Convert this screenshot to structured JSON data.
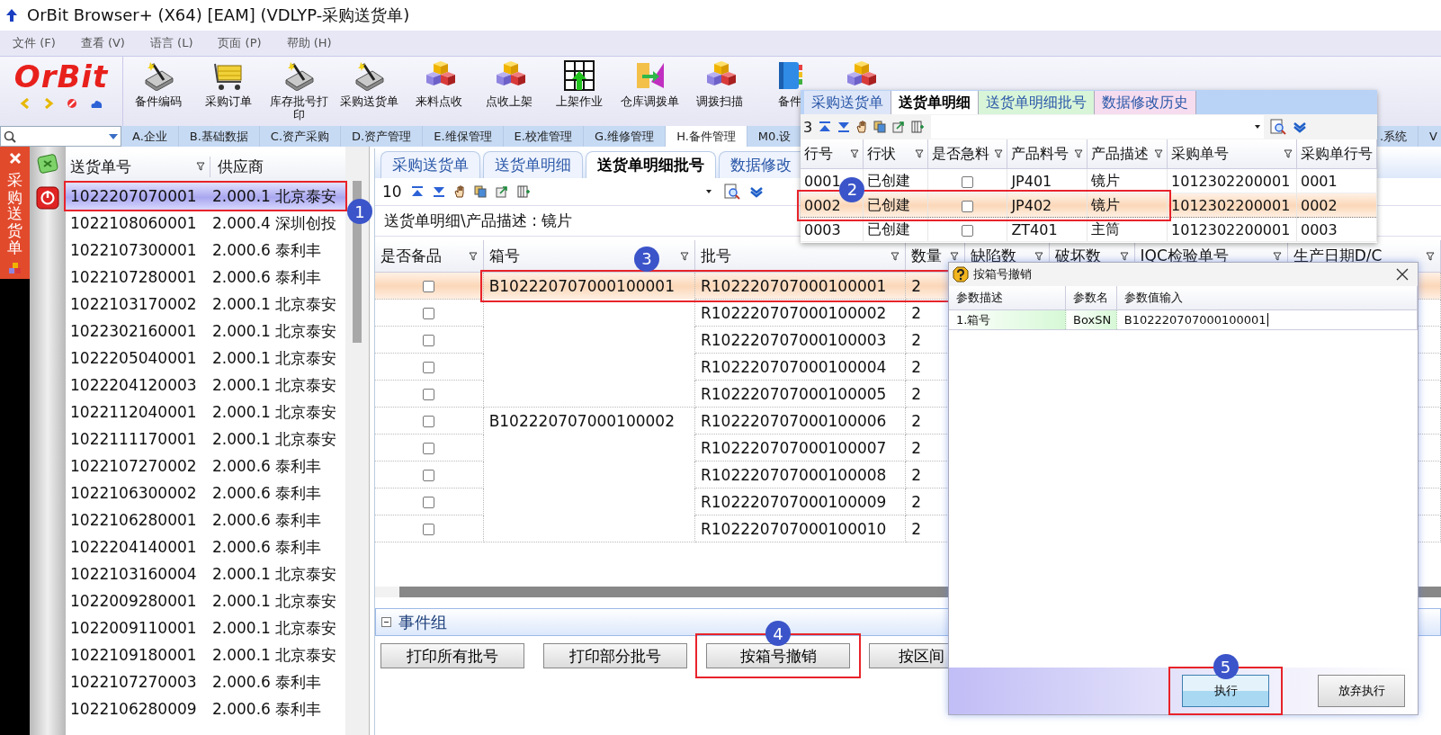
{
  "window": {
    "title": "OrBit Browser+ (X64) [EAM] (VDLYP-采购送货单)"
  },
  "menu": [
    "文件 (F)",
    "查看 (V)",
    "语言 (L)",
    "页面 (P)",
    "帮助 (H)"
  ],
  "logo": "OrBit",
  "toolbar": [
    {
      "label": "备件编码",
      "kind": "tray"
    },
    {
      "label": "采购订单",
      "kind": "cart"
    },
    {
      "label": "库存批号打印",
      "kind": "tray"
    },
    {
      "label": "采购送货单",
      "kind": "tray"
    },
    {
      "label": "来料点收",
      "kind": "cubes"
    },
    {
      "label": "点收上架",
      "kind": "cubes"
    },
    {
      "label": "上架作业",
      "kind": "grid"
    },
    {
      "label": "仓库调拨单",
      "kind": "transfer"
    },
    {
      "label": "调拨扫描",
      "kind": "cubes"
    },
    {
      "label": "备件",
      "kind": "binder"
    },
    {
      "kind": "cubes"
    }
  ],
  "module_tabs": [
    {
      "label": "A.企业",
      "selected": false
    },
    {
      "label": "B.基础数据",
      "selected": false
    },
    {
      "label": "C.资产采购",
      "selected": false
    },
    {
      "label": "D.资产管理",
      "selected": false
    },
    {
      "label": "E.维保管理",
      "selected": false
    },
    {
      "label": "E.校准管理",
      "selected": false
    },
    {
      "label": "G.维修管理",
      "selected": false
    },
    {
      "label": "H.备件管理",
      "selected": true
    },
    {
      "label": "M0.设",
      "selected": false
    },
    {
      "label": ".系统",
      "selected": false
    },
    {
      "label": "V",
      "selected": false
    }
  ],
  "side_tab": {
    "label": "采购送货单"
  },
  "order_list": {
    "columns": [
      "送货单号",
      "供应商"
    ],
    "rows": [
      {
        "order": "1022207070001",
        "supplier": "2.000.1 北京泰安",
        "selected": true,
        "marker": "1"
      },
      {
        "order": "1022108060001",
        "supplier": "2.000.4 深圳创投",
        "selected": false
      },
      {
        "order": "1022107300001",
        "supplier": "2.000.6 泰利丰",
        "selected": false
      },
      {
        "order": "1022107280001",
        "supplier": "2.000.6 泰利丰",
        "selected": false
      },
      {
        "order": "1022103170002",
        "supplier": "2.000.1 北京泰安",
        "selected": false
      },
      {
        "order": "1022302160001",
        "supplier": "2.000.1 北京泰安",
        "selected": false
      },
      {
        "order": "1022205040001",
        "supplier": "2.000.1 北京泰安",
        "selected": false
      },
      {
        "order": "1022204120003",
        "supplier": "2.000.1 北京泰安",
        "selected": false
      },
      {
        "order": "1022112040001",
        "supplier": "2.000.1 北京泰安",
        "selected": false
      },
      {
        "order": "1022111170001",
        "supplier": "2.000.1 北京泰安",
        "selected": false
      },
      {
        "order": "1022107270002",
        "supplier": "2.000.6 泰利丰",
        "selected": false
      },
      {
        "order": "1022106300002",
        "supplier": "2.000.6 泰利丰",
        "selected": false
      },
      {
        "order": "1022106280001",
        "supplier": "2.000.6 泰利丰",
        "selected": false
      },
      {
        "order": "1022204140001",
        "supplier": "2.000.6 泰利丰",
        "selected": false
      },
      {
        "order": "1022103160004",
        "supplier": "2.000.1 北京泰安",
        "selected": false
      },
      {
        "order": "1022009280001",
        "supplier": "2.000.1 北京泰安",
        "selected": false
      },
      {
        "order": "1022009110001",
        "supplier": "2.000.1 北京泰安",
        "selected": false
      },
      {
        "order": "1022109180001",
        "supplier": "2.000.1 北京泰安",
        "selected": false
      },
      {
        "order": "1022107270003",
        "supplier": "2.000.6 泰利丰",
        "selected": false
      },
      {
        "order": "1022106280009",
        "supplier": "2.000.6 泰利丰",
        "selected": false
      }
    ]
  },
  "detail_tabs": [
    {
      "label": "采购送货单",
      "selected": false
    },
    {
      "label": "送货单明细",
      "selected": false
    },
    {
      "label": "送货单明细批号",
      "selected": true
    },
    {
      "label": "数据修改",
      "selected": false
    }
  ],
  "detail_toolbar": {
    "count": "10"
  },
  "breadcrumb": "送货单明细\\产品描述 : 镜片",
  "batch_grid": {
    "columns": [
      "是否备品",
      "箱号",
      "批号",
      "数量",
      "缺陷数",
      "破坏数",
      "IQC检验单号",
      "生产日期D/C"
    ],
    "rows": [
      {
        "spare": false,
        "box": "B102220707000100001",
        "batch": "R102220707000100001",
        "qty": "2",
        "selected": true,
        "marker": "3"
      },
      {
        "spare": false,
        "batch": "R102220707000100002",
        "qty": "2",
        "selected": false
      },
      {
        "spare": false,
        "batch": "R102220707000100003",
        "qty": "2",
        "selected": false
      },
      {
        "spare": false,
        "batch": "R102220707000100004",
        "qty": "2",
        "selected": false
      },
      {
        "spare": false,
        "batch": "R102220707000100005",
        "qty": "2",
        "selected": false
      },
      {
        "spare": false,
        "box": "B102220707000100002",
        "batch": "R102220707000100006",
        "qty": "2",
        "selected": false
      },
      {
        "spare": false,
        "batch": "R102220707000100007",
        "qty": "2",
        "selected": false
      },
      {
        "spare": false,
        "batch": "R102220707000100008",
        "qty": "2",
        "selected": false
      },
      {
        "spare": false,
        "batch": "R102220707000100009",
        "qty": "2",
        "selected": false
      },
      {
        "spare": false,
        "batch": "R102220707000100010",
        "qty": "2",
        "selected": false
      }
    ]
  },
  "event_group": {
    "title": "事件组",
    "expanded": true,
    "buttons": [
      {
        "label": "打印所有批号"
      },
      {
        "label": "打印部分批号"
      },
      {
        "label": "按箱号撤销",
        "marker": "4"
      },
      {
        "label": "按区间"
      }
    ]
  },
  "popup": {
    "tabs": [
      {
        "label": "采购送货单",
        "selected": false,
        "color": "#dde6f8"
      },
      {
        "label": "送货单明细",
        "selected": true,
        "color": "#ffffff"
      },
      {
        "label": "送货单明细批号",
        "selected": false,
        "color": "#d8f5d8"
      },
      {
        "label": "数据修改历史",
        "selected": false,
        "color": "#f6dcef"
      }
    ],
    "count": "3",
    "columns": [
      "行号",
      "行状",
      "是否急料",
      "产品料号",
      "产品描述",
      "采购单号",
      "采购单行号"
    ],
    "rows": [
      {
        "line": "0001",
        "status": "已创建",
        "urgent": false,
        "part": "JP401",
        "desc": "镜片",
        "po": "1012302200001",
        "po_line": "0001",
        "selected": false
      },
      {
        "line": "0002",
        "status": "已创建",
        "urgent": false,
        "part": "JP402",
        "desc": "镜片",
        "po": "1012302200001",
        "po_line": "0002",
        "selected": true,
        "marker": "2"
      },
      {
        "line": "0003",
        "status": "已创建",
        "urgent": false,
        "part": "ZT401",
        "desc": "主筒",
        "po": "1012302200001",
        "po_line": "0003",
        "selected": false
      }
    ]
  },
  "dialog": {
    "title": "按箱号撤销",
    "columns": [
      "参数描述",
      "参数名",
      "参数值输入"
    ],
    "params": [
      {
        "desc": "1.箱号",
        "name": "BoxSN",
        "value": "B102220707000100001"
      }
    ],
    "buttons": [
      {
        "label": "执行",
        "kind": "primary",
        "marker": "5"
      },
      {
        "label": "放弃执行",
        "kind": "normal"
      }
    ]
  }
}
